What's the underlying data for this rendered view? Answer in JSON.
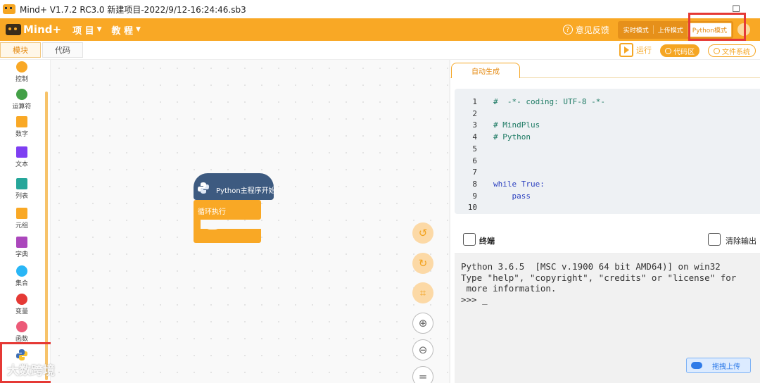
{
  "window": {
    "title": "Mind+ V1.7.2 RC3.0   新建项目-2022/9/12-16:24:46.sb3"
  },
  "menubar": {
    "logo": "Mind+",
    "menus": [
      {
        "label": "项 目"
      },
      {
        "label": "教 程"
      }
    ],
    "feedback": "意见反馈",
    "modes": [
      "实时模式",
      "上传模式",
      "Python模式"
    ]
  },
  "subbar": {
    "tabs": [
      "模块",
      "代码"
    ],
    "run_label": "运行",
    "code_area_label": "代码区",
    "file_system_label": "文件系统"
  },
  "sidebar": {
    "categories": [
      {
        "label": "控制",
        "color": "#f9a825"
      },
      {
        "label": "运算符",
        "color": "#43a047"
      },
      {
        "label": "数字",
        "color": "#f9a825"
      },
      {
        "label": "文本",
        "color": "#7e3ff2"
      },
      {
        "label": "列表",
        "color": "#26a69a"
      },
      {
        "label": "元组",
        "color": "#f9a825"
      },
      {
        "label": "字典",
        "color": "#ab47bc"
      },
      {
        "label": "集合",
        "color": "#29b6f6"
      },
      {
        "label": "变量",
        "color": "#e53935"
      },
      {
        "label": "函数",
        "color": "#ec5a78"
      },
      {
        "label": "",
        "color": "#3d6eb5"
      }
    ]
  },
  "workspace": {
    "hat_block": "Python主程序开始",
    "loop_block": "循环执行"
  },
  "code_panel": {
    "tab": "自动生成",
    "lines": [
      {
        "n": "1",
        "text": "#  -*- coding: UTF-8 -*-",
        "kind": "comment"
      },
      {
        "n": "2",
        "text": "",
        "kind": "plain"
      },
      {
        "n": "3",
        "text": "# MindPlus",
        "kind": "comment"
      },
      {
        "n": "4",
        "text": "# Python",
        "kind": "comment"
      },
      {
        "n": "5",
        "text": "",
        "kind": "plain"
      },
      {
        "n": "6",
        "text": "",
        "kind": "plain"
      },
      {
        "n": "7",
        "text": "",
        "kind": "plain"
      },
      {
        "n": "8",
        "text": "while True:",
        "kind": "keyword"
      },
      {
        "n": "9",
        "text": "    pass",
        "kind": "keyword"
      },
      {
        "n": "10",
        "text": "",
        "kind": "plain"
      }
    ]
  },
  "terminal": {
    "title": "终端",
    "clear_label": "清除输出",
    "lines": [
      "Python 3.6.5  [MSC v.1900 64 bit AMD64)] on win32",
      "Type \"help\", \"copyright\", \"credits\" or \"license\" for",
      " more information.",
      ">>> _"
    ],
    "drag_upload": "拖拽上传"
  },
  "watermark": "大数跨境"
}
